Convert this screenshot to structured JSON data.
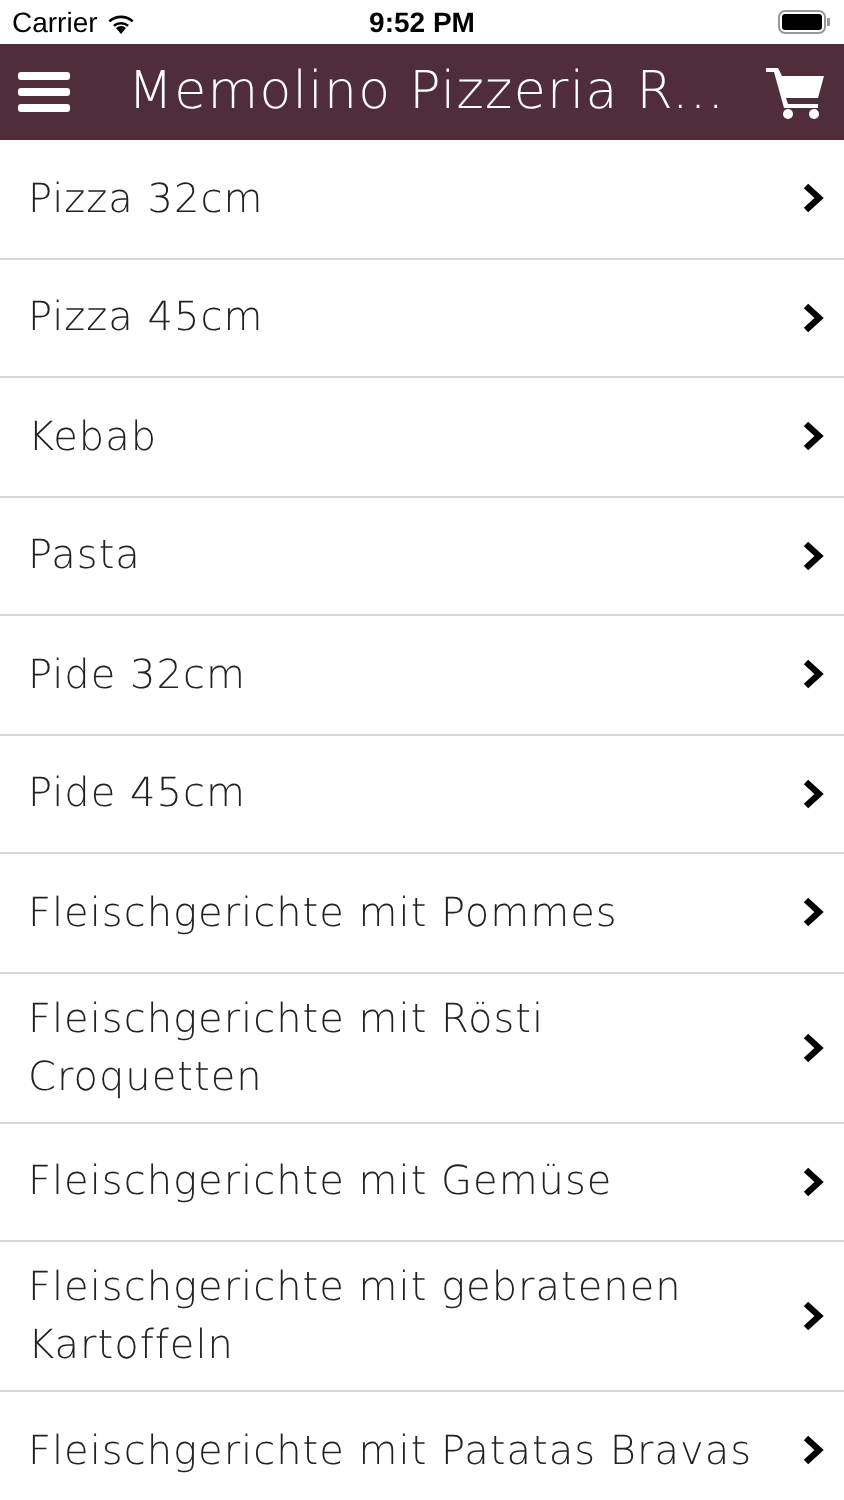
{
  "status_bar": {
    "carrier": "Carrier",
    "time": "9:52 PM"
  },
  "header": {
    "title": "Memolino Pizzeria R..."
  },
  "categories": [
    {
      "label": "Pizza 32cm"
    },
    {
      "label": "Pizza 45cm"
    },
    {
      "label": "Kebab"
    },
    {
      "label": "Pasta"
    },
    {
      "label": "Pide 32cm"
    },
    {
      "label": "Pide 45cm"
    },
    {
      "label": "Fleischgerichte mit Pommes"
    },
    {
      "label": "Fleischgerichte mit Rösti Croquetten"
    },
    {
      "label": "Fleischgerichte mit Gemüse"
    },
    {
      "label": "Fleischgerichte mit gebratenen Kartoffeln"
    },
    {
      "label": "Fleischgerichte mit Patatas Bravas"
    }
  ]
}
